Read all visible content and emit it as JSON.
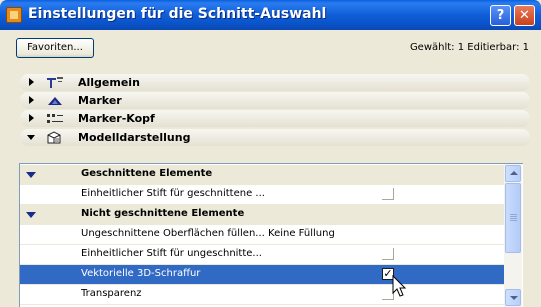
{
  "window": {
    "title": "Einstellungen für die Schnitt-Auswahl",
    "help_label": "?",
    "close_label": "✕"
  },
  "toolbar": {
    "favorites_label": "Favoriten...",
    "status": "Gewählt: 1 Editierbar: 1"
  },
  "sections": [
    {
      "label": "Allgemein",
      "expanded": false,
      "icon": "general-settings-icon"
    },
    {
      "label": "Marker",
      "expanded": false,
      "icon": "marker-icon"
    },
    {
      "label": "Marker-Kopf",
      "expanded": false,
      "icon": "marker-head-icon"
    },
    {
      "label": "Modelldarstellung",
      "expanded": true,
      "icon": "model-display-icon"
    }
  ],
  "list": {
    "rows": [
      {
        "type": "group",
        "label": "Geschnittene Elemente"
      },
      {
        "type": "item",
        "label": "Einheitlicher Stift für geschnittene ...",
        "checkbox": true,
        "checked": false
      },
      {
        "type": "group",
        "label": "Nicht geschnittene Elemente"
      },
      {
        "type": "item",
        "label": "Ungeschnittene Oberflächen füllen... Keine Füllung"
      },
      {
        "type": "item",
        "label": "Einheitlicher Stift für ungeschnitte...",
        "checkbox": true,
        "checked": false
      },
      {
        "type": "item",
        "label": "Vektorielle 3D-Schraffur",
        "checkbox": true,
        "checked": true,
        "selected": true
      },
      {
        "type": "item",
        "label": "Transparenz",
        "checkbox": true,
        "checked": false
      }
    ]
  },
  "colors": {
    "titlebar": "#0a5fdc",
    "selection": "#316ac5",
    "dialog_bg": "#ece9d8"
  }
}
